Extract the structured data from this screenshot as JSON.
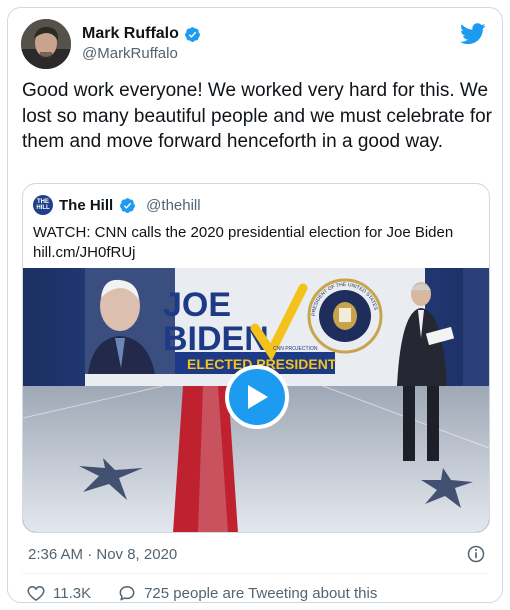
{
  "author": {
    "name": "Mark Ruffalo",
    "handle": "@MarkRuffalo",
    "verified": true
  },
  "tweet": {
    "text": "Good work everyone! We worked very hard for this. We lost so many beautiful people and we must celebrate for them and move forward henceforth in a good way.",
    "timestamp": "2:36 AM · Nov 8, 2020"
  },
  "quote": {
    "logo_text": "THE HILL",
    "name": "The Hill",
    "handle": "@thehill",
    "text": "WATCH: CNN calls the 2020 presidential election for Joe Biden",
    "link": "hill.cm/JH0fRUj",
    "video": {
      "line1": "JOE",
      "line2": "BIDEN",
      "banner": "ELECTED PRESIDENT",
      "projection_tag": "CNN PROJECTION",
      "seal_text": "PRESIDENT OF THE UNITED STATES"
    }
  },
  "actions": {
    "likes": "11.3K",
    "tweeting": "725 people are Tweeting about this"
  },
  "colors": {
    "accent": "#1d9bf0",
    "text": "#0f1419",
    "secondary": "#536471",
    "border": "#cfd9de"
  },
  "icons": [
    "twitter-bird-icon",
    "verified-icon",
    "play-icon",
    "info-icon",
    "heart-icon",
    "chat-bubble-icon"
  ]
}
